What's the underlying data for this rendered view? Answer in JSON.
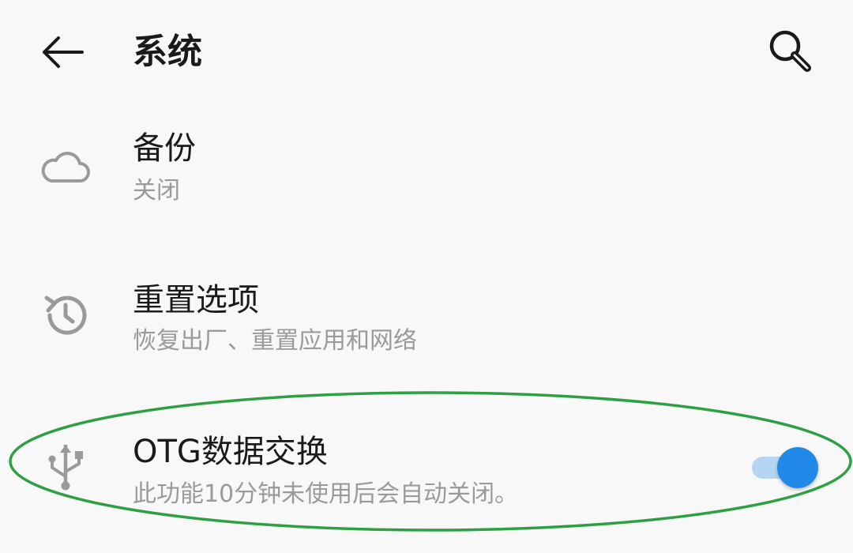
{
  "header": {
    "title": "系统"
  },
  "rows": [
    {
      "title": "备份",
      "subtitle": "关闭"
    },
    {
      "title": "重置选项",
      "subtitle": "恢复出厂、重置应用和网络"
    },
    {
      "title": "OTG数据交换",
      "subtitle": "此功能10分钟未使用后会自动关闭。",
      "toggle_on": true
    }
  ],
  "icons": {
    "back": "arrow-left-icon",
    "search": "search-icon",
    "backup": "cloud-icon",
    "reset": "history-icon",
    "otg": "usb-icon"
  },
  "colors": {
    "accent": "#2189e8",
    "annotation": "#2ea043"
  }
}
